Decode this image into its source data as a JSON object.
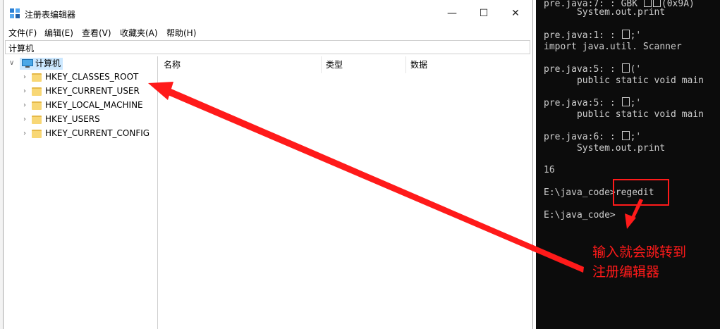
{
  "console": {
    "lines": [
      {
        "text": "pre.java:7: : GBK ",
        "y": 0
      },
      {
        "text": "      System.out.print",
        "y": 1
      },
      {
        "text": "pre.java:1: : ",
        "y": 3
      },
      {
        "text": "import java.util. Scanner",
        "y": 4
      },
      {
        "text": "pre.java:5: : ",
        "y": 6
      },
      {
        "text": "      public static void main",
        "y": 7
      },
      {
        "text": "pre.java:5: : ",
        "y": 9
      },
      {
        "text": "      public static void main",
        "y": 10
      },
      {
        "text": "pre.java:6: : ",
        "y": 12
      },
      {
        "text": "      System.out.print",
        "y": 13
      },
      {
        "text": "16",
        "y": 15
      },
      {
        "text": "E:\\java_code>regedit",
        "y": 17
      },
      {
        "text": "E:\\java_code>",
        "y": 19
      }
    ]
  },
  "window": {
    "title": "注册表编辑器",
    "minimize_glyph": "—",
    "maximize_glyph": "☐",
    "close_glyph": "✕",
    "menu": [
      "文件(F)",
      "编辑(E)",
      "查看(V)",
      "收藏夹(A)",
      "帮助(H)"
    ],
    "address": "计算机",
    "tree": {
      "root": "计算机",
      "items": [
        "HKEY_CLASSES_ROOT",
        "HKEY_CURRENT_USER",
        "HKEY_LOCAL_MACHINE",
        "HKEY_USERS",
        "HKEY_CURRENT_CONFIG"
      ]
    },
    "columns": [
      "名称",
      "类型",
      "数据"
    ]
  },
  "annotation": {
    "line1": "输入就会跳转到",
    "line2": "注册编辑器",
    "color": "#ff1a1a"
  }
}
